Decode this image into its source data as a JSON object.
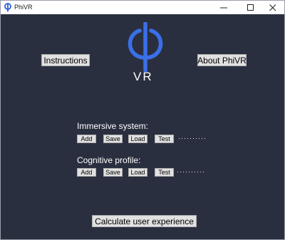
{
  "window": {
    "title": "PhiVR"
  },
  "logo": {
    "text": "VR",
    "color": "#3b6fe8"
  },
  "top_buttons": {
    "instructions": "Instructions",
    "about": "About PhiVR"
  },
  "immersive": {
    "label": "Immersive system:",
    "buttons": [
      "Add",
      "Save",
      "Load",
      "Test"
    ],
    "status": "··········"
  },
  "cognitive": {
    "label": "Cognitive profile:",
    "buttons": [
      "Add",
      "Save",
      "Load",
      "Test"
    ],
    "status": "··········"
  },
  "calculate": {
    "label": "Calculate user experience"
  },
  "colors": {
    "background": "#2a2f40",
    "accent": "#3b6fe8",
    "button": "#e1e1e1"
  }
}
